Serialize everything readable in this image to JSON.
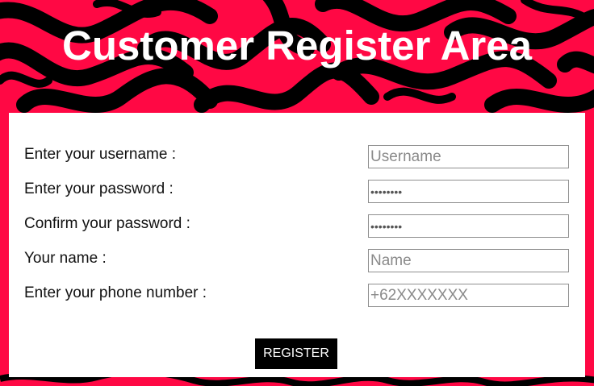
{
  "page": {
    "title": "Customer Register Area",
    "background_colors": [
      "#ff0844",
      "#000000"
    ]
  },
  "form": {
    "fields": [
      {
        "label": "Enter your username :",
        "placeholder": "Username",
        "type": "text",
        "value": ""
      },
      {
        "label": "Enter your password :",
        "placeholder": "",
        "type": "password",
        "value": "dummy123"
      },
      {
        "label": "Confirm your password :",
        "placeholder": "",
        "type": "password",
        "value": "dummy123"
      },
      {
        "label": "Your name :",
        "placeholder": "Name",
        "type": "text",
        "value": ""
      },
      {
        "label": "Enter your phone number :",
        "placeholder": "+62XXXXXXX",
        "type": "text",
        "value": ""
      }
    ],
    "submit_label": "REGISTER"
  }
}
